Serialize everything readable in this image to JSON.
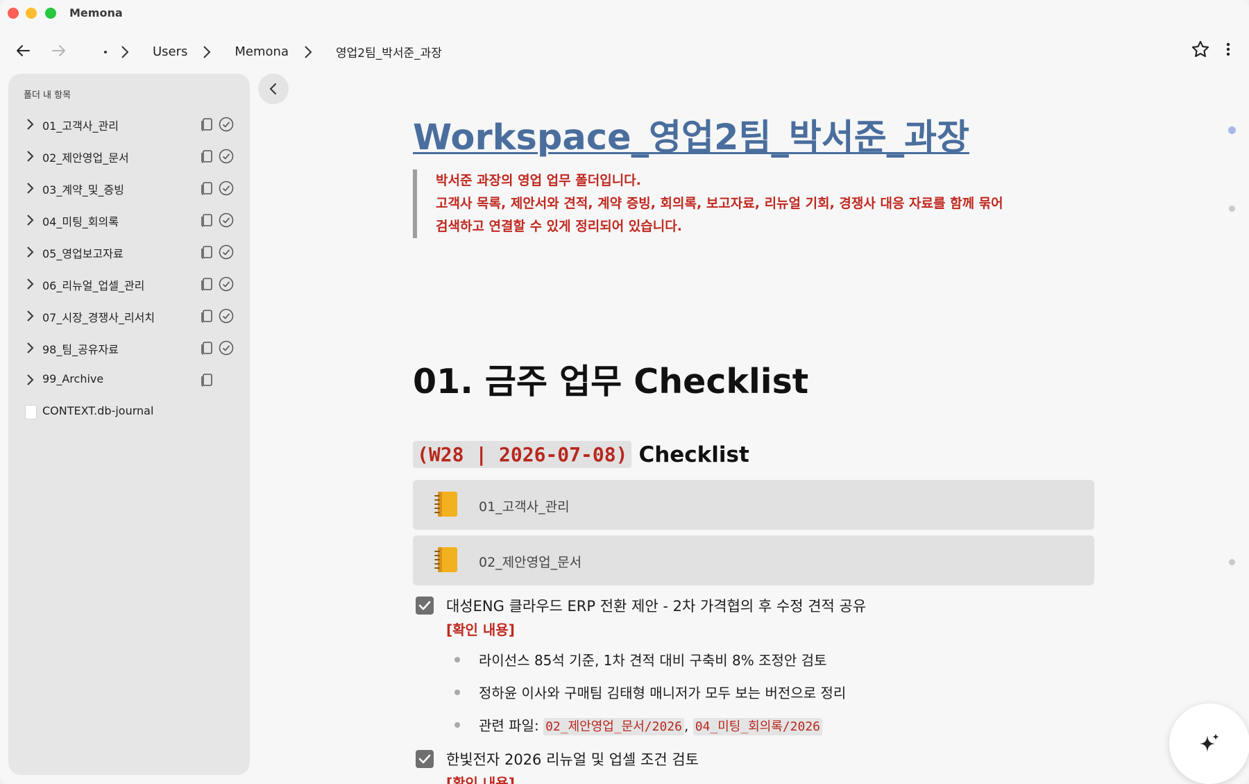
{
  "app": {
    "title": "Memona"
  },
  "toolbar": {
    "breadcrumb": [
      "Users",
      "Memona",
      "영업2팀_박서준_과장"
    ]
  },
  "sidebar": {
    "title": "폴더 내 항목",
    "items": [
      {
        "label": "01_고객사_관리",
        "type": "folder",
        "synced": true
      },
      {
        "label": "02_제안영업_문서",
        "type": "folder",
        "synced": true
      },
      {
        "label": "03_계약_및_증빙",
        "type": "folder",
        "synced": true
      },
      {
        "label": "04_미팅_회의록",
        "type": "folder",
        "synced": true
      },
      {
        "label": "05_영업보고자료",
        "type": "folder",
        "synced": true
      },
      {
        "label": "06_리뉴얼_업셀_관리",
        "type": "folder",
        "synced": true
      },
      {
        "label": "07_시장_경쟁사_리서치",
        "type": "folder",
        "synced": true
      },
      {
        "label": "98_팀_공유자료",
        "type": "folder",
        "synced": true
      },
      {
        "label": "99_Archive",
        "type": "folder",
        "synced": false
      },
      {
        "label": "CONTEXT.db-journal",
        "type": "file",
        "synced": false
      }
    ]
  },
  "document": {
    "title": "Workspace_영업2팀_박서준_과장",
    "intro": [
      "박서준 과장의 영업 업무 폴더입니다.",
      "고객사 목록, 제안서와 견적, 계약 증빙, 회의록, 보고자료, 리뉴얼 기회, 경쟁사 대응 자료를 함께 묶어",
      "검색하고 연결할 수 있게 정리되어 있습니다."
    ],
    "section_heading": "01. 금주 업무 Checklist",
    "checklist_code": "(W28 | 2026-07-08)",
    "checklist_title": "Checklist",
    "linked_notebooks": [
      "01_고객사_관리",
      "02_제안영업_문서"
    ],
    "tasks": [
      {
        "text": "대성ENG 클라우드 ERP 전환 제안 - 2차 가격협의 후 수정 견적 공유",
        "checked": true,
        "confirm_label": "[확인 내용]",
        "bullets": [
          "라이선스 85석 기준, 1차 견적 대비 구축비 8% 조정안 검토",
          "정하윤 이사와 구매팀 김태형 매니저가 모두 보는 버전으로 정리"
        ],
        "files_label": "관련 파일:",
        "files": [
          "02_제안영업_문서/2026",
          "04_미팅_회의록/2026"
        ]
      },
      {
        "text": "한빛전자 2026 리뉴얼 및 업셀 조건 검토",
        "checked": true,
        "confirm_label": "[확인 내용]"
      }
    ]
  },
  "colors": {
    "title_link": "#4a6e9d",
    "accent_red": "#c0281f",
    "sidebar_bg": "#e6e6e6",
    "card_bg": "#e1e1e1"
  },
  "icons": {
    "back": "arrow-left-icon",
    "forward": "arrow-right-icon",
    "star": "star-icon",
    "more": "more-vertical-icon",
    "ai": "sparkle-icon",
    "notebook": "notebook-icon"
  }
}
